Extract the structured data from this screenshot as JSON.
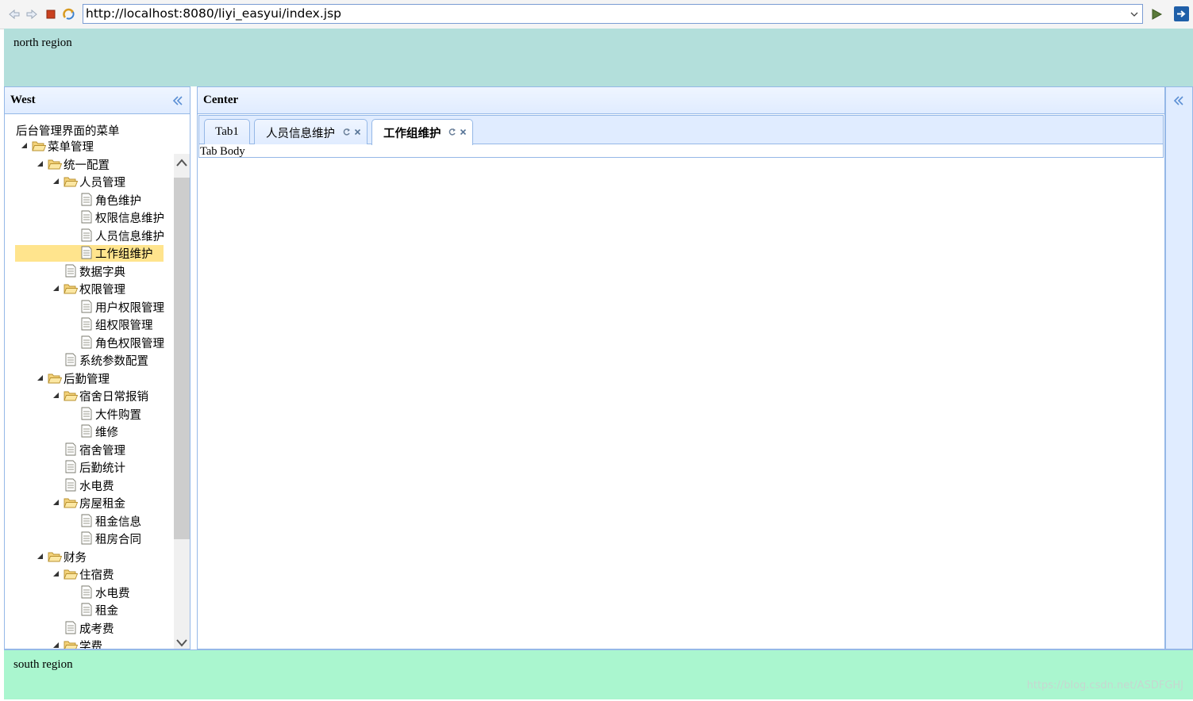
{
  "browser": {
    "url": "http://localhost:8080/liyi_easyui/index.jsp"
  },
  "north": {
    "text": "north region"
  },
  "south": {
    "text": "south region"
  },
  "west": {
    "title": "West",
    "tree_root": "后台管理界面的菜单",
    "tree": [
      {
        "label": "菜单管理",
        "level": 0,
        "type": "folder"
      },
      {
        "label": "统一配置",
        "level": 1,
        "type": "folder"
      },
      {
        "label": "人员管理",
        "level": 2,
        "type": "folder"
      },
      {
        "label": "角色维护",
        "level": 3,
        "type": "file"
      },
      {
        "label": "权限信息维护",
        "level": 3,
        "type": "file"
      },
      {
        "label": "人员信息维护",
        "level": 3,
        "type": "file"
      },
      {
        "label": "工作组维护",
        "level": 3,
        "type": "file",
        "selected": true
      },
      {
        "label": "数据字典",
        "level": 2,
        "type": "file"
      },
      {
        "label": "权限管理",
        "level": 2,
        "type": "folder"
      },
      {
        "label": "用户权限管理",
        "level": 3,
        "type": "file"
      },
      {
        "label": "组权限管理",
        "level": 3,
        "type": "file"
      },
      {
        "label": "角色权限管理",
        "level": 3,
        "type": "file"
      },
      {
        "label": "系统参数配置",
        "level": 2,
        "type": "file"
      },
      {
        "label": "后勤管理",
        "level": 1,
        "type": "folder"
      },
      {
        "label": "宿舍日常报销",
        "level": 2,
        "type": "folder"
      },
      {
        "label": "大件购置",
        "level": 3,
        "type": "file"
      },
      {
        "label": "维修",
        "level": 3,
        "type": "file"
      },
      {
        "label": "宿舍管理",
        "level": 2,
        "type": "file"
      },
      {
        "label": "后勤统计",
        "level": 2,
        "type": "file"
      },
      {
        "label": "水电费",
        "level": 2,
        "type": "file"
      },
      {
        "label": "房屋租金",
        "level": 2,
        "type": "folder"
      },
      {
        "label": "租金信息",
        "level": 3,
        "type": "file"
      },
      {
        "label": "租房合同",
        "level": 3,
        "type": "file"
      },
      {
        "label": "财务",
        "level": 1,
        "type": "folder"
      },
      {
        "label": "住宿费",
        "level": 2,
        "type": "folder"
      },
      {
        "label": "水电费",
        "level": 3,
        "type": "file"
      },
      {
        "label": "租金",
        "level": 3,
        "type": "file"
      },
      {
        "label": "成考费",
        "level": 2,
        "type": "file"
      },
      {
        "label": "学费",
        "level": 2,
        "type": "folder"
      }
    ]
  },
  "center": {
    "title": "Center",
    "tabs": [
      {
        "label": "Tab1",
        "active": false,
        "closable": false
      },
      {
        "label": "人员信息维护",
        "active": false,
        "closable": true
      },
      {
        "label": "工作组维护",
        "active": true,
        "closable": true
      }
    ],
    "tab_body": "Tab Body"
  },
  "watermark": "https://blog.csdn.net/ASDFGHJ"
}
